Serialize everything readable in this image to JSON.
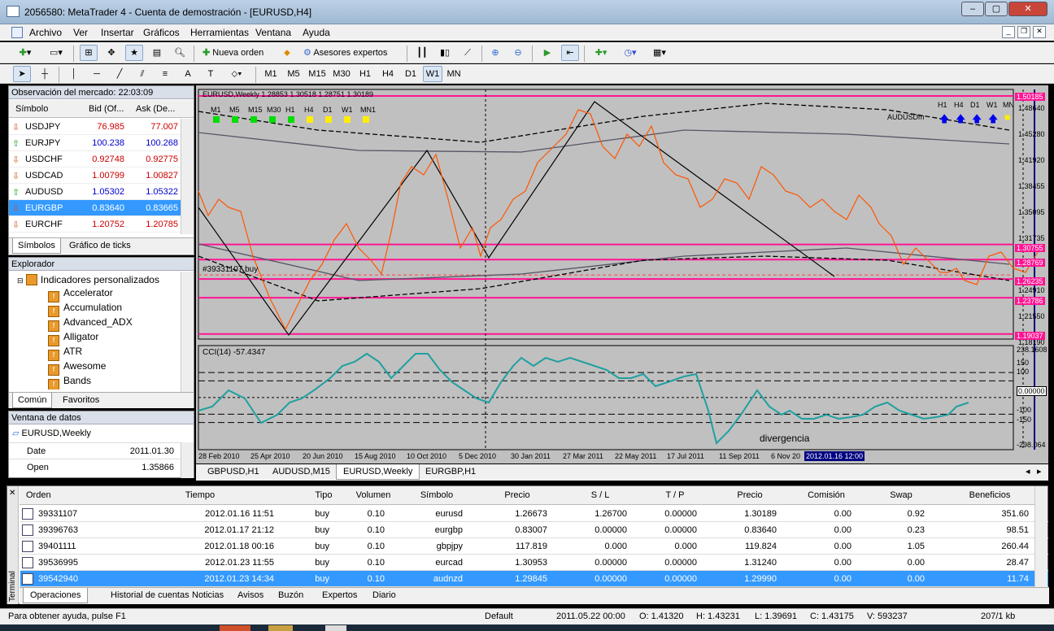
{
  "window": {
    "title": "2056580: MetaTrader 4 - Cuenta de demostración - [EURUSD,H4]"
  },
  "menu": [
    "Archivo",
    "Ver",
    "Insertar",
    "Gráficos",
    "Herramientas",
    "Ventana",
    "Ayuda"
  ],
  "toolbar": {
    "new_order": "Nueva orden",
    "experts": "Asesores expertos",
    "timeframes": [
      "M1",
      "M5",
      "M15",
      "M30",
      "H1",
      "H4",
      "D1",
      "W1",
      "MN"
    ],
    "active_timeframe": "W1",
    "text_tool": "A"
  },
  "market_watch": {
    "header": "Observación del mercado: 22:03:09",
    "columns": [
      "Símbolo",
      "Bid (Of...",
      "Ask (De..."
    ],
    "rows": [
      {
        "symbol": "USDJPY",
        "bid": "76.985",
        "ask": "77.007",
        "dir": "down"
      },
      {
        "symbol": "EURJPY",
        "bid": "100.238",
        "ask": "100.268",
        "dir": "up"
      },
      {
        "symbol": "USDCHF",
        "bid": "0.92748",
        "ask": "0.92775",
        "dir": "down"
      },
      {
        "symbol": "USDCAD",
        "bid": "1.00799",
        "ask": "1.00827",
        "dir": "down"
      },
      {
        "symbol": "AUDUSD",
        "bid": "1.05302",
        "ask": "1.05322",
        "dir": "up"
      },
      {
        "symbol": "EURGBP",
        "bid": "0.83640",
        "ask": "0.83665",
        "dir": "down"
      },
      {
        "symbol": "EURCHF",
        "bid": "1.20752",
        "ask": "1.20785",
        "dir": "down"
      }
    ],
    "tabs": [
      "Símbolos",
      "Gráfico de ticks"
    ]
  },
  "navigator": {
    "header": "Explorador",
    "root": "Indicadores personalizados",
    "items": [
      "Accelerator",
      "Accumulation",
      "Advanced_ADX",
      "Alligator",
      "ATR",
      "Awesome",
      "Bands"
    ],
    "tabs": [
      "Común",
      "Favoritos"
    ]
  },
  "data_window": {
    "header": "Ventana de datos",
    "symbol": "EURUSD,Weekly",
    "rows": [
      {
        "label": "Date",
        "value": "2011.01.30"
      },
      {
        "label": "Open",
        "value": "1.35866"
      }
    ]
  },
  "chart": {
    "info": "EURUSD,Weekly  1.28853 1.30518 1.28751 1.30189",
    "mtf_left": {
      "labels": [
        "M1",
        "M5",
        "M15",
        "M30",
        "H1",
        "H4",
        "D1",
        "W1",
        "MN1"
      ],
      "colors": [
        "#00dd00",
        "#00dd00",
        "#00dd00",
        "#00dd00",
        "#00dd00",
        "#ffee00",
        "#ffee00",
        "#ffee00",
        "#ffee00"
      ]
    },
    "mtf_right": {
      "labels": [
        "H1",
        "H4",
        "D1",
        "W1",
        "MN"
      ],
      "symbol": "AUDUSDm"
    },
    "order_label": "#39331107 buy",
    "price_axis": [
      "1.48640",
      "1.45280",
      "1.41920",
      "1.38455",
      "1.35095",
      "1.31735",
      "1.28150",
      "1.24910",
      "1.21550",
      "1.18190"
    ],
    "level_tags": [
      "1.50185",
      "1.30755",
      "1.28769",
      "1.26235",
      "1.23786",
      "1.19037"
    ],
    "date_axis": [
      "28 Feb 2010",
      "25 Apr 2010",
      "20 Jun 2010",
      "15 Aug 2010",
      "10 Oct 2010",
      "5 Dec 2010",
      "30 Jan 2011",
      "27 Mar 2011",
      "22 May 2011",
      "17 Jul 2011",
      "11 Sep 2011",
      "6 Nov 20"
    ],
    "cursor_date": "2012.01.16 12:00",
    "cci_label": "CCI(14) -57.4347",
    "cci_axis": [
      "238.1608",
      "150",
      "100",
      "0.00000",
      "-100",
      "-150",
      "-298.064"
    ],
    "annotation": "divergencia",
    "tabs": [
      "GBPUSD,H1",
      "AUDUSD,M15",
      "EURUSD,Weekly",
      "EURGBP,H1"
    ],
    "active_tab": "EURUSD,Weekly"
  },
  "chart_data": {
    "type": "line",
    "series": [],
    "y_axis_ticks": [
      1.4864,
      1.4528,
      1.4192,
      1.38455,
      1.35095,
      1.31735,
      1.2815,
      1.2491,
      1.2155,
      1.1819
    ],
    "horizontal_levels": [
      1.50185,
      1.30755,
      1.28769,
      1.26235,
      1.23786,
      1.19037
    ],
    "cci": {
      "title": "CCI(14) -57.4347",
      "levels": [
        150,
        100,
        0,
        -100,
        -150
      ],
      "ylim": [
        -298.064,
        238.1608
      ]
    }
  },
  "terminal": {
    "columns": [
      "Orden",
      "Tiempo",
      "Tipo",
      "Volumen",
      "Símbolo",
      "Precio",
      "S / L",
      "T / P",
      "Precio",
      "Comisión",
      "Swap",
      "Beneficios"
    ],
    "rows": [
      [
        "39331107",
        "2012.01.16 11:51",
        "buy",
        "0.10",
        "eurusd",
        "1.26673",
        "1.26700",
        "0.00000",
        "1.30189",
        "0.00",
        "0.92",
        "351.60"
      ],
      [
        "39396763",
        "2012.01.17 21:12",
        "buy",
        "0.10",
        "eurgbp",
        "0.83007",
        "0.00000",
        "0.00000",
        "0.83640",
        "0.00",
        "0.23",
        "98.51"
      ],
      [
        "39401111",
        "2012.01.18 00:16",
        "buy",
        "0.10",
        "gbpjpy",
        "117.819",
        "0.000",
        "0.000",
        "119.824",
        "0.00",
        "1.05",
        "260.44"
      ],
      [
        "39536995",
        "2012.01.23 11:55",
        "buy",
        "0.10",
        "eurcad",
        "1.30953",
        "0.00000",
        "0.00000",
        "1.31240",
        "0.00",
        "0.00",
        "28.47"
      ],
      [
        "39542940",
        "2012.01.23 14:34",
        "buy",
        "0.10",
        "audnzd",
        "1.29845",
        "0.00000",
        "0.00000",
        "1.29990",
        "0.00",
        "0.00",
        "11.74"
      ]
    ],
    "tabs": [
      "Operaciones",
      "Historial de cuentas",
      "Noticias",
      "Avisos",
      "Buzón",
      "Expertos",
      "Diario"
    ],
    "side_label": "Terminal"
  },
  "status": {
    "help": "Para obtener ayuda, pulse F1",
    "profile": "Default",
    "datetime": "2011.05.22 00:00",
    "open": "O: 1.41320",
    "high": "H: 1.43231",
    "low": "L: 1.39691",
    "close": "C: 1.43175",
    "volume": "V: 593237",
    "traffic": "207/1 kb"
  }
}
